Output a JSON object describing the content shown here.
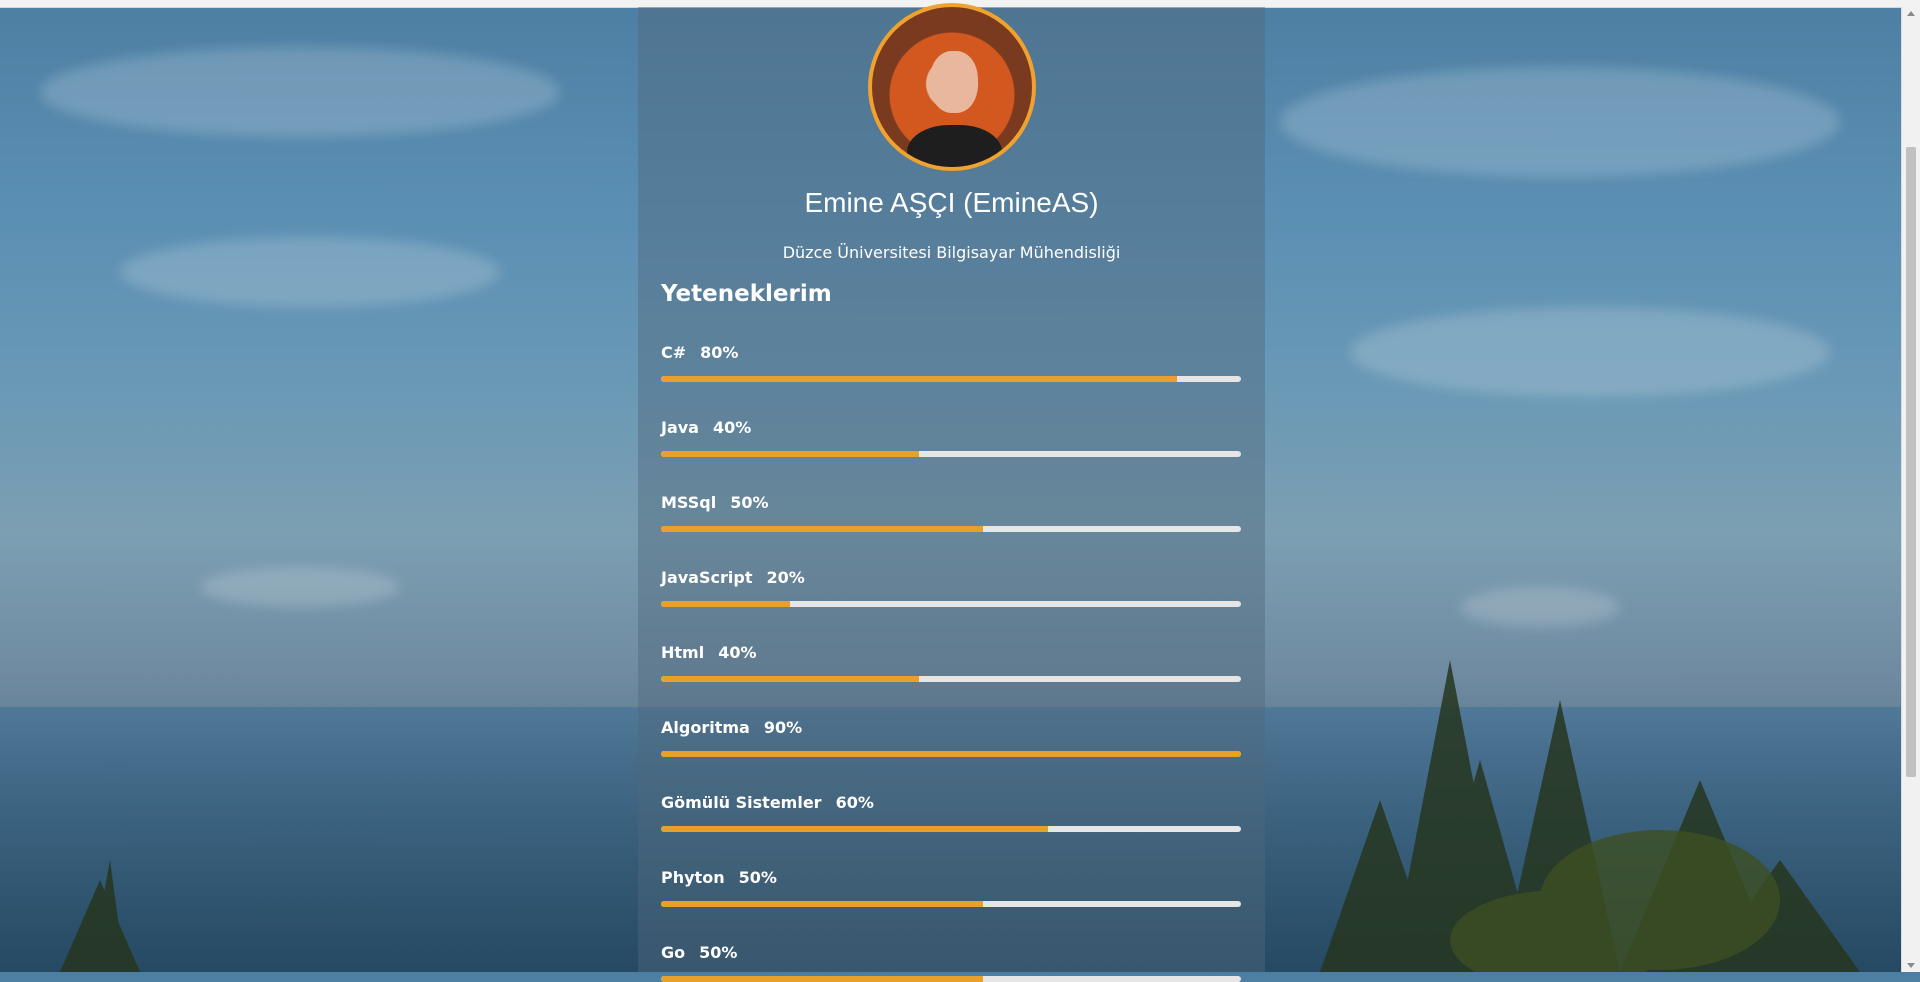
{
  "profile": {
    "name": "Emine AŞÇI (EmineAS)",
    "subtitle": "Düzce Üniversitesi Bilgisayar Mühendisliği"
  },
  "skills_title": "Yeteneklerim",
  "skills": [
    {
      "label": "C#",
      "percent_text": "80%",
      "fill": 0.89
    },
    {
      "label": "Java",
      "percent_text": "40%",
      "fill": 0.445
    },
    {
      "label": "MSSql",
      "percent_text": "50%",
      "fill": 0.556
    },
    {
      "label": "JavaScript",
      "percent_text": "20%",
      "fill": 0.222
    },
    {
      "label": "Html",
      "percent_text": "40%",
      "fill": 0.445
    },
    {
      "label": "Algoritma",
      "percent_text": "90%",
      "fill": 1.0
    },
    {
      "label": "Gömülü Sistemler",
      "percent_text": "60%",
      "fill": 0.667
    },
    {
      "label": "Phyton",
      "percent_text": "50%",
      "fill": 0.556
    },
    {
      "label": "Go",
      "percent_text": "50%",
      "fill": 0.556
    }
  ],
  "colors": {
    "accent": "#e8a02a",
    "track": "#e6e6e6",
    "text": "#ffffff"
  }
}
